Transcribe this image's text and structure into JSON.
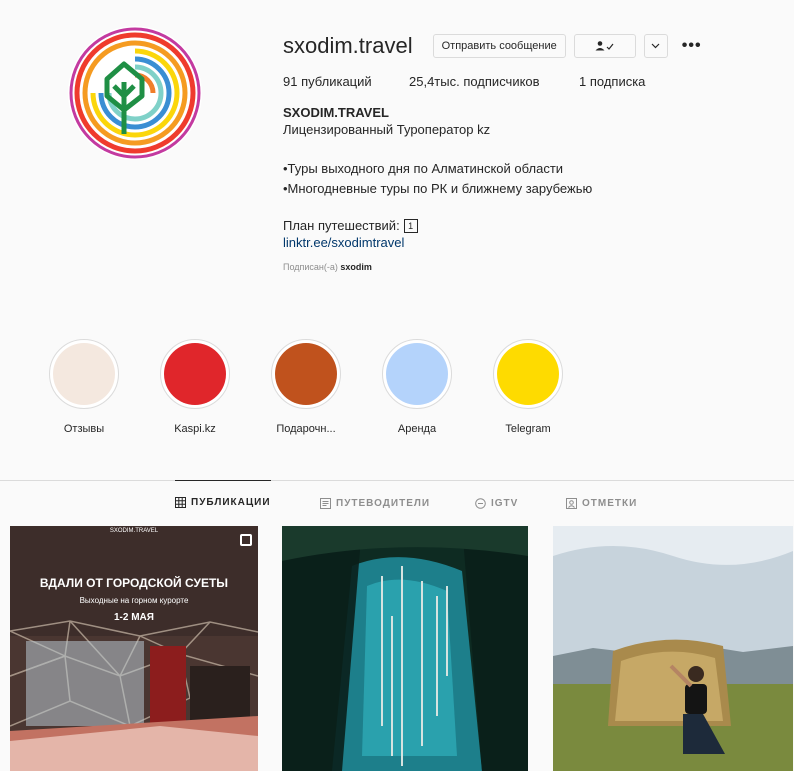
{
  "profile": {
    "username": "sxodim.travel",
    "message_button": "Отправить сообщение",
    "follow_icon": "person-check-icon",
    "more_icon": "more-icon",
    "stats": {
      "posts": "91 публикаций",
      "followers": "25,4тыс. подписчиков",
      "following": "1 подписка"
    },
    "full_name": "SXODIM.TRAVEL",
    "bio": [
      "Лицензированный Туроператор kz",
      "•Туры выходного дня по Алматинской области",
      "•Многодневные туры по РК и ближнему зарубежью"
    ],
    "plan_label": "План путешествий:",
    "plan_badge": "1",
    "link": "linktr.ee/sxodimtravel",
    "subscribed_prefix": "Подписан(-а)",
    "subscribed_user": "sxodim"
  },
  "highlights": [
    {
      "label": "Отзывы",
      "color": "#f4e8df"
    },
    {
      "label": "Kaspi.kz",
      "color": "#e0262b"
    },
    {
      "label": "Подарочн...",
      "color": "#c0521d"
    },
    {
      "label": "Аренда",
      "color": "#b4d3fb"
    },
    {
      "label": "Telegram",
      "color": "#fedb00"
    }
  ],
  "tabs": [
    {
      "label": "ПУБЛИКАЦИИ",
      "icon": "grid-icon",
      "active": true
    },
    {
      "label": "ПУТЕВОДИТЕЛИ",
      "icon": "guide-icon",
      "active": false
    },
    {
      "label": "IGTV",
      "icon": "igtv-icon",
      "active": false
    },
    {
      "label": "ОТМЕТКИ",
      "icon": "tag-icon",
      "active": false
    }
  ],
  "posts": {
    "first": {
      "logo_text": "SXODIM.TRAVEL",
      "title": "ВДАЛИ ОТ ГОРОДСКОЙ СУЕТЫ",
      "subtitle": "Выходные на горном курорте",
      "date": "1-2 МАЯ"
    }
  },
  "colors": {
    "text": "#262626",
    "muted": "#8e8e8e",
    "link": "#00376b",
    "border": "#dbdbdb"
  }
}
